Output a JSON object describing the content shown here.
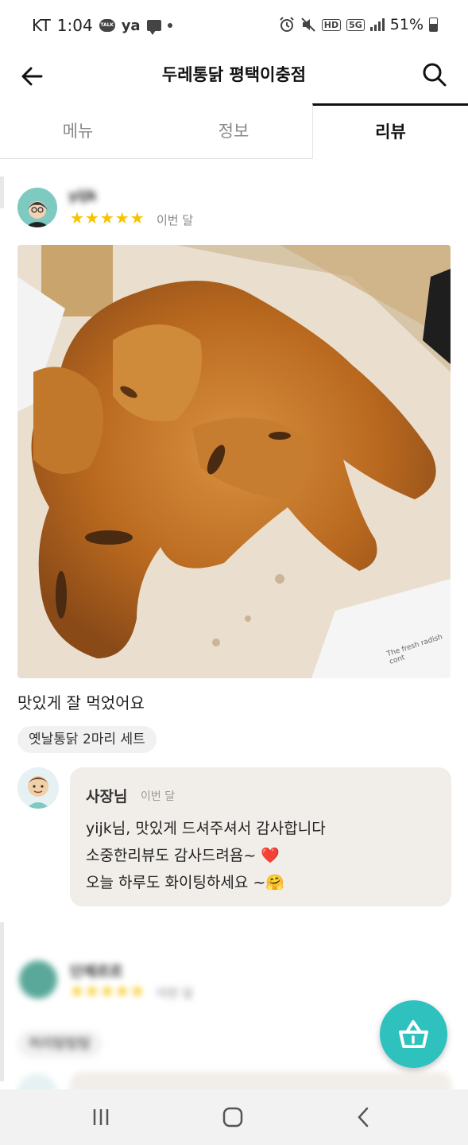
{
  "status_bar": {
    "carrier": "KT",
    "time": "1:04",
    "talk_label": "TALK",
    "ya_label": "ya",
    "hd_label": "HD",
    "network_label": "5G",
    "battery": "51%"
  },
  "header": {
    "title": "두레통닭 평택이충점"
  },
  "tabs": [
    {
      "label": "메뉴"
    },
    {
      "label": "정보"
    },
    {
      "label": "리뷰"
    }
  ],
  "review1": {
    "name": "yijk",
    "stars": "★★★★★",
    "date": "이번 달",
    "text": "맛있게 잘 먹었어요",
    "menu_chip": "옛날통닭 2마리 세트",
    "photo_caption": "The fresh radish cont"
  },
  "reply": {
    "owner": "사장님",
    "date": "이번 달",
    "line1": "yijk님, 맛있게 드셔주셔서 감사합니다",
    "line2": "소중한리뷰도 감사드려욤~ ❤️",
    "line3": "오늘 하루도 화이팅하세요 ~🤗"
  },
  "review2": {
    "name": "단제르르",
    "stars": "★★★★★",
    "date": "이번 달",
    "menu_chip": "허리탐탐탐"
  },
  "colors": {
    "accent": "#2ec1bd",
    "star": "#f7c300",
    "reply_bg": "#f1eee9"
  },
  "icons": {
    "back": "arrow-left",
    "search": "magnifier",
    "cart": "basket",
    "nav_recent": "three-bars",
    "nav_home": "rounded-square",
    "nav_back": "chevron-left"
  }
}
